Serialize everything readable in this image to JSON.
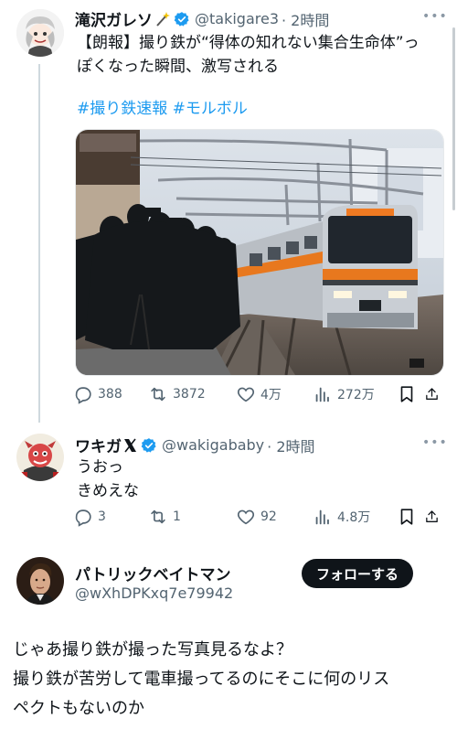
{
  "tweet1": {
    "name": "滝沢ガレソ",
    "name_badge": "sparkle-wand-icon",
    "handle": "@takigare3",
    "time": "· 2時間",
    "text_line1": "【朗報】撮り鉄が“得体の知れない集合生命体”っ",
    "text_line2": "ぽくなった瞬間、激写される",
    "hashtags": "#撮り鉄速報 #モルボル",
    "stats": {
      "replies": "388",
      "retweets": "3872",
      "likes": "4万",
      "views": "272万"
    }
  },
  "tweet2": {
    "name": "ワキガ",
    "name_badge": "x-logo-icon",
    "handle": "@wakigababy",
    "time": "· 2時間",
    "text_line1": "うおっ",
    "text_line2": "きめえな",
    "stats": {
      "replies": "3",
      "retweets": "1",
      "likes": "92",
      "views": "4.8万"
    }
  },
  "tweet3": {
    "name": "パトリックベイトマン",
    "handle": "@wXhDPKxq7e79942",
    "follow_label": "フォローする",
    "text_line1": "じゃあ撮り鉄が撮った写真見るなよ？",
    "text_line2": "撮り鉄が苦労して電車撮ってるのにそこに何のリス",
    "text_line3": "ペクトもないのか"
  },
  "colors": {
    "accent": "#1d9bf0",
    "secondary_text": "#536471",
    "train_stripe": "#e8781e"
  }
}
